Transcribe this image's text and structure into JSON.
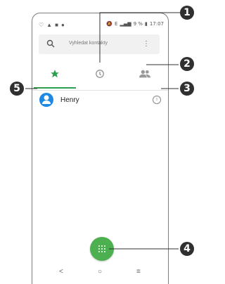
{
  "status_bar": {
    "time": "17:07",
    "battery": "9 %",
    "network": "E"
  },
  "search": {
    "placeholder": "Vyhledat kontakty"
  },
  "tabs": [
    {
      "icon": "star-icon",
      "selected": true
    },
    {
      "icon": "clock-icon",
      "selected": false
    },
    {
      "icon": "people-icon",
      "selected": false
    }
  ],
  "contacts": [
    {
      "name": "Henry",
      "icon": "info-icon"
    }
  ],
  "fab": {
    "icon": "dialpad-icon",
    "color": "#4caf50"
  },
  "nav": {
    "back": "<",
    "home": "○",
    "recents": "≡"
  },
  "callouts": {
    "c1": "1",
    "c2": "2",
    "c3": "3",
    "c4": "4",
    "c5": "5"
  },
  "colors": {
    "accent": "#2e9e4f",
    "avatar": "#1e88e5"
  }
}
